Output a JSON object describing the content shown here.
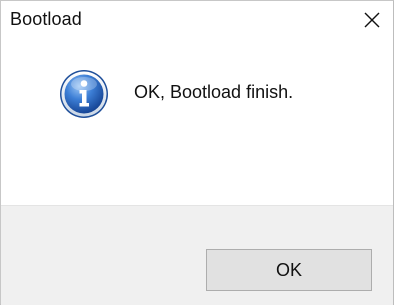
{
  "window": {
    "title": "Bootload",
    "close_icon": "close-icon"
  },
  "message": {
    "icon": "info-icon",
    "text": "OK, Bootload finish."
  },
  "buttons": {
    "ok_label": "OK"
  },
  "colors": {
    "footer_bg": "#f0f0f0",
    "button_bg": "#e1e1e1",
    "button_border": "#adadad",
    "info_icon_blue": "#2a5fb0"
  }
}
